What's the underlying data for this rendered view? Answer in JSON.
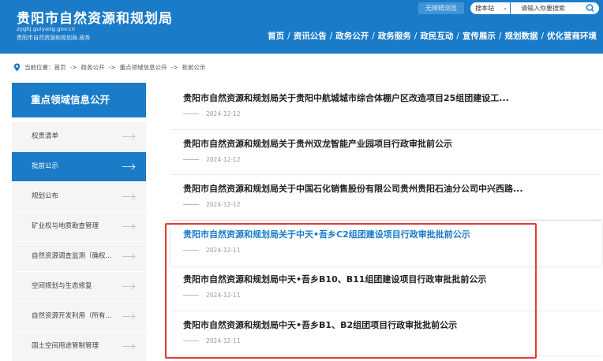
{
  "header": {
    "site_title": "贵阳市自然资源和规划局",
    "site_url": "zyghj.guiyang.gov.cn",
    "site_sub": "贵阳市自然资源和规划局.政务",
    "accessibility_label": "无障碍浏览",
    "search_scope": "搜本站",
    "search_placeholder": "请输入你要搜索",
    "nav": [
      "首页",
      "资讯公告",
      "政务公开",
      "政务服务",
      "政民互动",
      "宣传展示",
      "规划数据",
      "优化营商环境"
    ],
    "nav_separator": "/"
  },
  "breadcrumb": {
    "prefix": "当前位置：",
    "items": [
      "首页",
      "政务公开",
      "重点领域信息公开",
      "批前公示"
    ],
    "separator": "->"
  },
  "sidebar": {
    "title": "重点领域信息公开",
    "items": [
      {
        "label": "权责清单",
        "active": false
      },
      {
        "label": "批前公示",
        "active": true
      },
      {
        "label": "规划公布",
        "active": false
      },
      {
        "label": "矿业权与地质勘查管理",
        "active": false
      },
      {
        "label": "自然资源调查监测（确权...",
        "active": false
      },
      {
        "label": "空间规划与生态修复",
        "active": false
      },
      {
        "label": "自然资源开发利用（所有...",
        "active": false
      },
      {
        "label": "国土空间用途管制管理",
        "active": false
      }
    ]
  },
  "articles": [
    {
      "title": "贵阳市自然资源和规划局关于贵阳中航城城市综合体棚户区改造项目25组团建设工...",
      "date": "2024-12-12",
      "hover": false
    },
    {
      "title": "贵阳市自然资源和规划局关于贵州双龙智能产业园项目行政审批前公示",
      "date": "2024-12-12",
      "hover": false
    },
    {
      "title": "贵阳市自然资源和规划局关于中国石化销售股份有限公司贵州贵阳石油分公司中兴西路...",
      "date": "2024-12-12",
      "hover": false
    },
    {
      "title": "贵阳市自然资源和规划局关于中天•吾乡C2组团建设项目行政审批批前公示",
      "date": "2024-12-11",
      "hover": true
    },
    {
      "title": "贵阳市自然资源和规划局中天•吾乡B10、B11组团建设项目行政审批批前公示",
      "date": "2024-12-11",
      "hover": false
    },
    {
      "title": "贵阳市自然资源和规划局中天•吾乡B1、B2组团项目行政审批批前公示",
      "date": "2024-12-11",
      "hover": false
    }
  ],
  "colors": {
    "primary": "#1a7bc8",
    "highlight_box": "#e53935",
    "sidebar_bg": "#f5f5f5"
  }
}
